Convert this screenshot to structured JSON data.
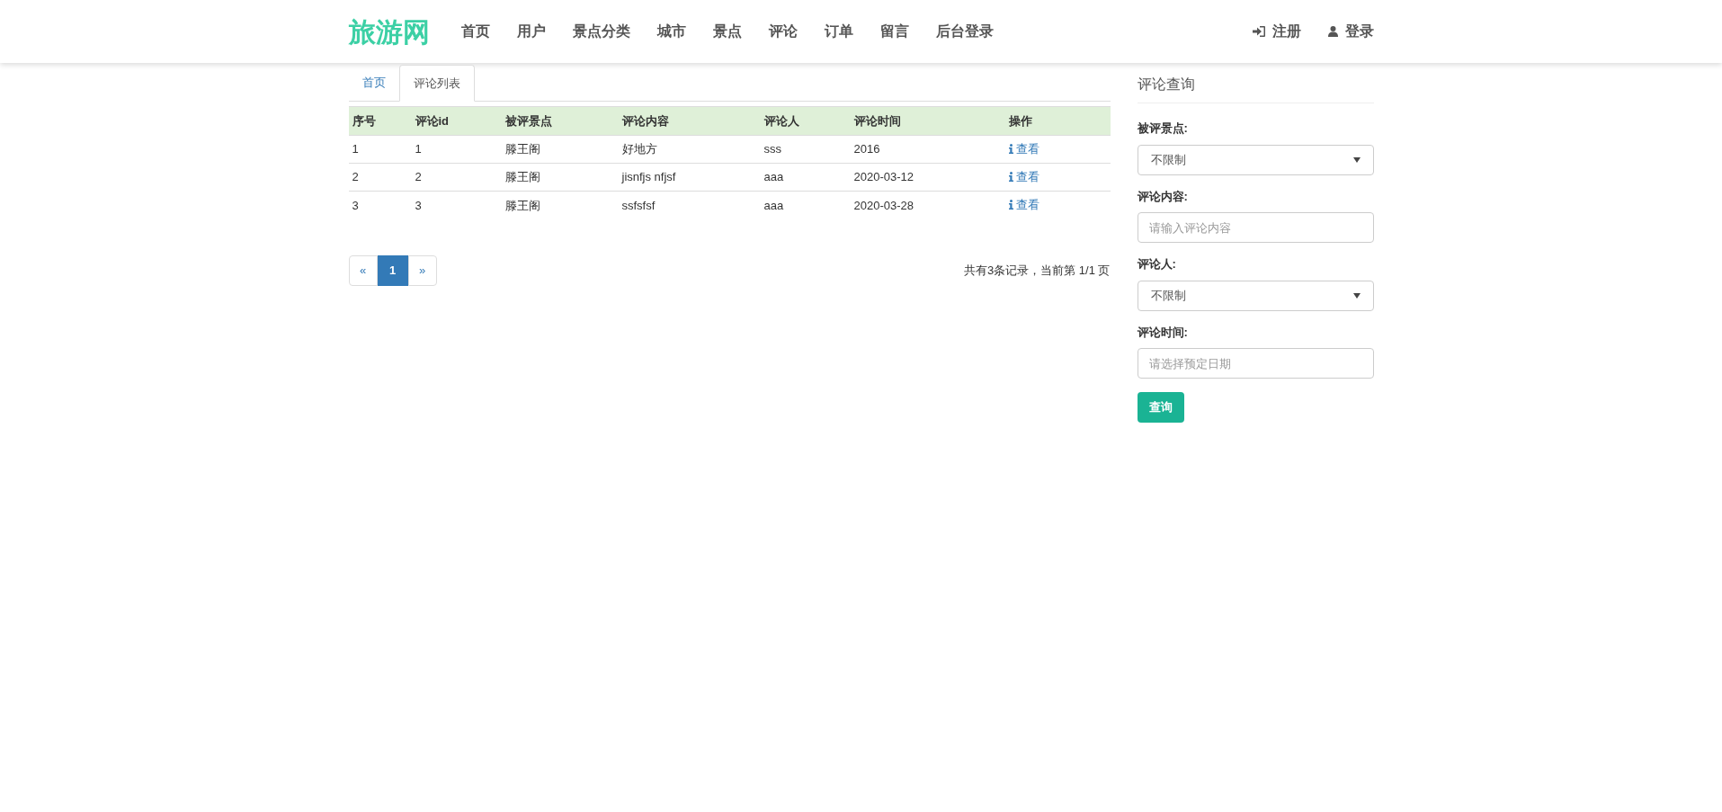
{
  "navbar": {
    "logo": "旅游网",
    "items": [
      "首页",
      "用户",
      "景点分类",
      "城市",
      "景点",
      "评论",
      "订单",
      "留言",
      "后台登录"
    ],
    "right": [
      {
        "kind": "register",
        "label": "注册"
      },
      {
        "kind": "login",
        "label": "登录"
      }
    ]
  },
  "tabs": [
    {
      "label": "首页",
      "selected": false
    },
    {
      "label": "评论列表",
      "selected": true
    }
  ],
  "table": {
    "columns": [
      "序号",
      "评论id",
      "被评景点",
      "评论内容",
      "评论人",
      "评论时间",
      "操作"
    ],
    "rows": [
      [
        "1",
        "1",
        "滕王阁",
        "好地方",
        "sss",
        "2016",
        "查看"
      ],
      [
        "2",
        "2",
        "滕王阁",
        "jisnfjs nfjsf",
        "aaa",
        "2020-03-12",
        "查看"
      ],
      [
        "3",
        "3",
        "滕王阁",
        "ssfsfsf",
        "aaa",
        "2020-03-28",
        "查看"
      ]
    ]
  },
  "pagination": {
    "prev": "«",
    "pages": [
      {
        "label": "1",
        "selected": true
      }
    ],
    "next": "»",
    "summary": "共有3条记录，当前第 1/1 页"
  },
  "sidebar": {
    "title": "评论查询",
    "fields": [
      {
        "label": "被评景点:",
        "kind": "select",
        "value": "不限制"
      },
      {
        "label": "评论内容:",
        "kind": "input",
        "placeholder": "请输入评论内容"
      },
      {
        "label": "评论人:",
        "kind": "select",
        "value": "不限制"
      },
      {
        "label": "评论时间:",
        "kind": "input",
        "placeholder": "请选择预定日期"
      }
    ],
    "button": "查询"
  }
}
